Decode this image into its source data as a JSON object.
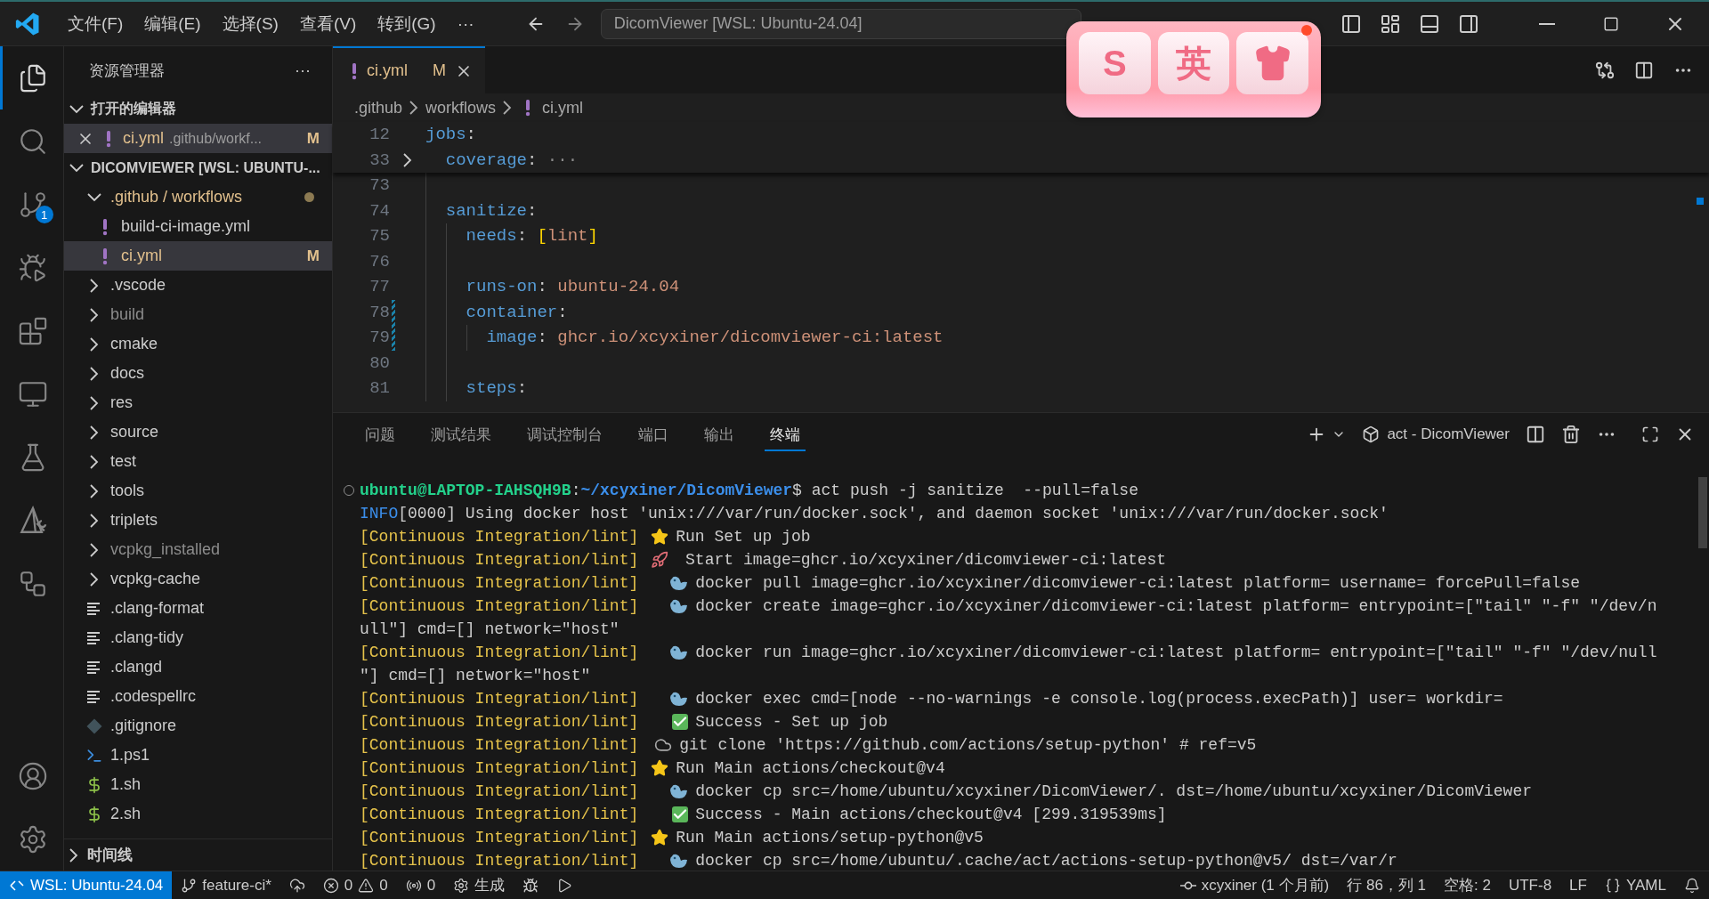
{
  "title_bar": {
    "menus": [
      "文件(F)",
      "编辑(E)",
      "选择(S)",
      "查看(V)",
      "转到(G)",
      "···"
    ],
    "command_center": "DicomViewer [WSL: Ubuntu-24.04]"
  },
  "floating_widget": {
    "keys": [
      {
        "kind": "text",
        "label": "S"
      },
      {
        "kind": "text",
        "label": "英"
      },
      {
        "kind": "shirt"
      }
    ],
    "notification": true
  },
  "activity_bar": {
    "items": [
      {
        "kind": "explorer",
        "selected": true
      },
      {
        "kind": "search",
        "selected": false
      },
      {
        "kind": "source_control",
        "selected": false,
        "badge": "1"
      },
      {
        "kind": "run_debug",
        "selected": false
      },
      {
        "kind": "extensions",
        "selected": false
      },
      {
        "kind": "remote",
        "selected": false
      },
      {
        "kind": "testing",
        "selected": false
      },
      {
        "kind": "tool",
        "selected": false
      },
      {
        "kind": "graph",
        "selected": false
      }
    ],
    "bottom": [
      {
        "kind": "account"
      },
      {
        "kind": "settings"
      }
    ]
  },
  "sidebar": {
    "title": "资源管理器",
    "more": "···",
    "open_editors": {
      "title": "打开的编辑器",
      "expanded": true,
      "items": [
        {
          "name": "ci.yml",
          "path": ".github/workf...",
          "badge": "M",
          "selected": true
        }
      ]
    },
    "workspace": {
      "title": "DICOMVIEWER [WSL: UBUNTU-...",
      "expanded": true,
      "items": [
        {
          "name": ".github / workflows",
          "kind": "folder",
          "expanded": true,
          "modified": true,
          "selected": false,
          "children": [
            {
              "name": "build-ci-image.yml",
              "kind": "yaml",
              "selected": false
            },
            {
              "name": "ci.yml",
              "kind": "yaml",
              "badge": "M",
              "selected": true
            }
          ]
        },
        {
          "name": ".vscode",
          "kind": "folder",
          "expanded": false,
          "selected": false
        },
        {
          "name": "build",
          "kind": "folder",
          "expanded": false,
          "dimmed": true,
          "selected": false
        },
        {
          "name": "cmake",
          "kind": "folder",
          "expanded": false,
          "selected": false
        },
        {
          "name": "docs",
          "kind": "folder",
          "expanded": false,
          "selected": false
        },
        {
          "name": "res",
          "kind": "folder",
          "expanded": false,
          "selected": false
        },
        {
          "name": "source",
          "kind": "folder",
          "expanded": false,
          "selected": false
        },
        {
          "name": "test",
          "kind": "folder",
          "expanded": false,
          "selected": false
        },
        {
          "name": "tools",
          "kind": "folder",
          "expanded": false,
          "selected": false
        },
        {
          "name": "triplets",
          "kind": "folder",
          "expanded": false,
          "selected": false
        },
        {
          "name": "vcpkg_installed",
          "kind": "folder",
          "expanded": false,
          "dimmed": true,
          "selected": false
        },
        {
          "name": "vcpkg-cache",
          "kind": "folder",
          "expanded": false,
          "selected": false
        },
        {
          "name": ".clang-format",
          "kind": "config",
          "selected": false
        },
        {
          "name": ".clang-tidy",
          "kind": "config",
          "selected": false
        },
        {
          "name": ".clangd",
          "kind": "config",
          "selected": false
        },
        {
          "name": ".codespellrc",
          "kind": "config",
          "selected": false
        },
        {
          "name": ".gitignore",
          "kind": "git",
          "selected": false
        },
        {
          "name": "1.ps1",
          "kind": "powershell",
          "selected": false
        },
        {
          "name": "1.sh",
          "kind": "shell",
          "selected": false
        },
        {
          "name": "2.sh",
          "kind": "shell",
          "selected": false
        }
      ]
    },
    "timeline": {
      "title": "时间线",
      "expanded": false
    }
  },
  "editor": {
    "tabs": [
      {
        "name": "ci.yml",
        "badge": "M",
        "selected": true
      }
    ],
    "breadcrumb": [
      ".github",
      "workflows",
      "ci.yml"
    ],
    "sticky_lines": [
      {
        "number": "12",
        "code": [
          {
            "text": "jobs",
            "kind": "key"
          },
          {
            "text": ":",
            "kind": "punct"
          }
        ]
      },
      {
        "number": "33",
        "folded": true,
        "code": [
          {
            "text": "  coverage",
            "kind": "key"
          },
          {
            "text": ":",
            "kind": "punct"
          },
          {
            "text": " ···",
            "kind": "fold"
          }
        ]
      }
    ],
    "lines": [
      {
        "number": "73"
      },
      {
        "number": "74",
        "code": [
          {
            "text": "  sanitize",
            "kind": "key"
          },
          {
            "text": ":",
            "kind": "punct"
          }
        ]
      },
      {
        "number": "75",
        "code": [
          {
            "text": "    needs",
            "kind": "key"
          },
          {
            "text": ": ",
            "kind": "punct"
          },
          {
            "text": "[",
            "kind": "bracket"
          },
          {
            "text": "lint",
            "kind": "value"
          },
          {
            "text": "]",
            "kind": "bracket"
          }
        ]
      },
      {
        "number": "76"
      },
      {
        "number": "77",
        "code": [
          {
            "text": "    runs-on",
            "kind": "key"
          },
          {
            "text": ": ",
            "kind": "punct"
          },
          {
            "text": "ubuntu-24.04",
            "kind": "value"
          }
        ]
      },
      {
        "number": "78",
        "modified": true,
        "code": [
          {
            "text": "    container",
            "kind": "key"
          },
          {
            "text": ":",
            "kind": "punct"
          }
        ]
      },
      {
        "number": "79",
        "modified": true,
        "code": [
          {
            "text": "      image",
            "kind": "key"
          },
          {
            "text": ": ",
            "kind": "punct"
          },
          {
            "text": "ghcr.io/xcyxiner/dicomviewer-ci:latest",
            "kind": "value"
          }
        ]
      },
      {
        "number": "80"
      },
      {
        "number": "81",
        "code": [
          {
            "text": "    steps",
            "kind": "key"
          },
          {
            "text": ":",
            "kind": "punct"
          }
        ]
      }
    ]
  },
  "panel": {
    "tabs": [
      {
        "label": "问题",
        "selected": false
      },
      {
        "label": "测试结果",
        "selected": false
      },
      {
        "label": "调试控制台",
        "selected": false
      },
      {
        "label": "端口",
        "selected": false
      },
      {
        "label": "输出",
        "selected": false
      },
      {
        "label": "终端",
        "selected": true
      }
    ],
    "terminal_name": "act - DicomViewer",
    "terminal": [
      {
        "kind": "prompt",
        "user": "ubuntu@LAPTOP-IAHSQH9B",
        "sep": ":",
        "path": "~/xcyxiner/DicomViewer",
        "text": "$ act push -j sanitize  --pull=false"
      },
      {
        "kind": "info",
        "prefix": "INFO",
        "text": "[0000] Using docker host 'unix:///var/run/docker.sock', and daemon socket 'unix:///var/run/docker.sock'"
      },
      {
        "kind": "log",
        "prefix": "[Continuous Integration/lint]",
        "marker": {
          "kind": "step"
        },
        "text": "Run Set up job"
      },
      {
        "kind": "log",
        "prefix": "[Continuous Integration/lint]",
        "marker": {
          "kind": "start"
        },
        "text": " Start image=ghcr.io/xcyxiner/dicomviewer-ci:latest"
      },
      {
        "kind": "log",
        "prefix": "[Continuous Integration/lint]",
        "marker": {
          "kind": "docker"
        },
        "text": "docker pull image=ghcr.io/xcyxiner/dicomviewer-ci:latest platform= username= forcePull=false"
      },
      {
        "kind": "log",
        "prefix": "[Continuous Integration/lint]",
        "marker": {
          "kind": "docker"
        },
        "text": "docker create image=ghcr.io/xcyxiner/dicomviewer-ci:latest platform= entrypoint=[\"tail\" \"-f\" \"/dev/n"
      },
      {
        "kind": "wrap",
        "text": "ull\"] cmd=[] network=\"host\""
      },
      {
        "kind": "log",
        "prefix": "[Continuous Integration/lint]",
        "marker": {
          "kind": "docker"
        },
        "text": "docker run image=ghcr.io/xcyxiner/dicomviewer-ci:latest platform= entrypoint=[\"tail\" \"-f\" \"/dev/null"
      },
      {
        "kind": "wrap",
        "text": "\"] cmd=[] network=\"host\""
      },
      {
        "kind": "log",
        "prefix": "[Continuous Integration/lint]",
        "marker": {
          "kind": "docker"
        },
        "text": "docker exec cmd=[node --no-warnings -e console.log(process.execPath)] user= workdir="
      },
      {
        "kind": "log",
        "prefix": "[Continuous Integration/lint]",
        "marker": {
          "kind": "success"
        },
        "text": "Success - Set up job"
      },
      {
        "kind": "log",
        "prefix": "[Continuous Integration/lint]",
        "marker": {
          "kind": "git"
        },
        "text": "git clone 'https://github.com/actions/setup-python' # ref=v5"
      },
      {
        "kind": "log",
        "prefix": "[Continuous Integration/lint]",
        "marker": {
          "kind": "step"
        },
        "text": "Run Main actions/checkout@v4"
      },
      {
        "kind": "log",
        "prefix": "[Continuous Integration/lint]",
        "marker": {
          "kind": "docker"
        },
        "text": "docker cp src=/home/ubuntu/xcyxiner/DicomViewer/. dst=/home/ubuntu/xcyxiner/DicomViewer"
      },
      {
        "kind": "log",
        "prefix": "[Continuous Integration/lint]",
        "marker": {
          "kind": "success"
        },
        "text": "Success - Main actions/checkout@v4 [299.319539ms]"
      },
      {
        "kind": "log",
        "prefix": "[Continuous Integration/lint]",
        "marker": {
          "kind": "step"
        },
        "text": "Run Main actions/setup-python@v5"
      },
      {
        "kind": "log",
        "prefix": "[Continuous Integration/lint]",
        "marker": {
          "kind": "docker"
        },
        "text": "docker cp src=/home/ubuntu/.cache/act/actions-setup-python@v5/ dst=/var/r"
      }
    ]
  },
  "status_bar": {
    "left": [
      {
        "kind": "remote",
        "label": "WSL: Ubuntu-24.04"
      },
      {
        "kind": "branch",
        "label": "feature-ci*"
      },
      {
        "kind": "sync"
      },
      {
        "kind": "problems",
        "errors": "0",
        "warnings": "0"
      },
      {
        "kind": "ports",
        "label": "0"
      },
      {
        "kind": "build",
        "label": "生成"
      },
      {
        "kind": "debug"
      },
      {
        "kind": "run"
      }
    ],
    "right": [
      {
        "kind": "blame",
        "label": "xcyxiner (1 个月前)"
      },
      {
        "kind": "text",
        "label": "行 86，列 1"
      },
      {
        "kind": "text",
        "label": "空格: 2"
      },
      {
        "kind": "text",
        "label": "UTF-8"
      },
      {
        "kind": "text",
        "label": "LF"
      },
      {
        "kind": "language",
        "label": "YAML"
      },
      {
        "kind": "bell"
      }
    ]
  }
}
